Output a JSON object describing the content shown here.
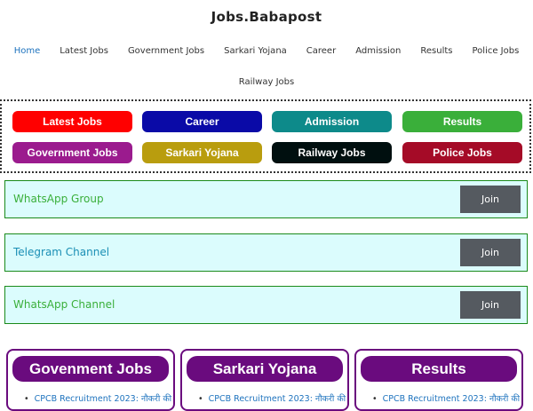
{
  "site": {
    "title": "Jobs.Babapost"
  },
  "nav": {
    "row1": [
      "Home",
      "Latest Jobs",
      "Government Jobs",
      "Sarkari Yojana",
      "Career",
      "Admission",
      "Results",
      "Police Jobs"
    ],
    "row2": [
      "Railway Jobs"
    ],
    "active": "Home"
  },
  "category_buttons": [
    {
      "label": "Latest Jobs",
      "color": "#ff0000"
    },
    {
      "label": "Career",
      "color": "#0a0aa7"
    },
    {
      "label": "Admission",
      "color": "#0d8a8a"
    },
    {
      "label": "Results",
      "color": "#3aaf3a"
    },
    {
      "label": "Government Jobs",
      "color": "#9b1b8e"
    },
    {
      "label": "Sarkari Yojana",
      "color": "#b99d0e"
    },
    {
      "label": "Railway Jobs",
      "color": "#000f0f"
    },
    {
      "label": "Police Jobs",
      "color": "#a50b27"
    }
  ],
  "join_boxes": [
    {
      "label": "WhatsApp Group",
      "color": "#3aaf3a",
      "button": "Join"
    },
    {
      "label": "Telegram Channel",
      "color": "#1b8fb5",
      "button": "Join"
    },
    {
      "label": "WhatsApp Channel",
      "color": "#3aaf3a",
      "button": "Join"
    }
  ],
  "cards": [
    {
      "title": "Govenment Jobs",
      "item": "CPCB Recruitment 2023: नौकरी की"
    },
    {
      "title": "Sarkari Yojana",
      "item": "CPCB Recruitment 2023: नौकरी की"
    },
    {
      "title": "Results",
      "item": "CPCB Recruitment 2023: नौकरी की"
    }
  ]
}
